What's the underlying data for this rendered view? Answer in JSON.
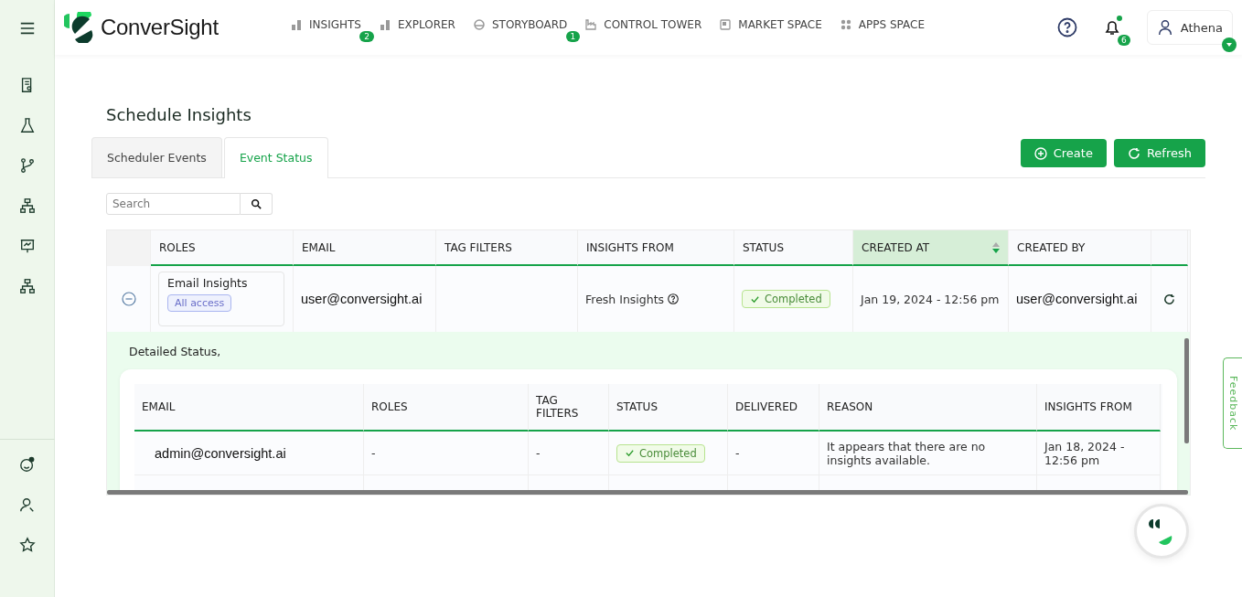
{
  "brand": "ConverSight",
  "nav": [
    {
      "label": "INSIGHTS",
      "badge": "2"
    },
    {
      "label": "EXPLORER"
    },
    {
      "label": "STORYBOARD",
      "badge": "1"
    },
    {
      "label": "CONTROL TOWER"
    },
    {
      "label": "MARKET SPACE"
    },
    {
      "label": "APPS SPACE"
    }
  ],
  "notifications": {
    "badge": "6",
    "unread": true
  },
  "user": {
    "name": "Athena"
  },
  "page_title": "Schedule Insights",
  "tabs": [
    {
      "label": "Scheduler Events",
      "selected": false
    },
    {
      "label": "Event Status",
      "selected": true
    }
  ],
  "buttons": [
    "Create",
    "Refresh"
  ],
  "search": {
    "placeholder": "Search"
  },
  "table": {
    "columns": [
      {
        "label": "ROLES",
        "sorted": false
      },
      {
        "label": "EMAIL",
        "sorted": false
      },
      {
        "label": "TAG FILTERS",
        "sorted": false
      },
      {
        "label": "INSIGHTS FROM",
        "sorted": false
      },
      {
        "label": "STATUS",
        "sorted": false
      },
      {
        "label": "CREATED AT",
        "sorted": true
      },
      {
        "label": "CREATED BY",
        "sorted": false
      }
    ],
    "rows": [
      {
        "expanded": true,
        "role": "Email Insights",
        "access": "All access",
        "email": "user@conversight.ai",
        "insights_from": "Fresh Insights",
        "status": "Completed",
        "created_at": "Jan 19, 2024 - 12:56 pm",
        "created_by": "user@conversight.ai"
      }
    ]
  },
  "detail": {
    "title": "Detailed Status,",
    "columns": [
      "EMAIL",
      "ROLES",
      "TAG FILTERS",
      "STATUS",
      "DELIVERED",
      "REASON",
      "INSIGHTS FROM"
    ],
    "rows": [
      {
        "email": "admin@conversight.ai",
        "roles": "-",
        "tag_filters": "-",
        "status": "Completed",
        "delivered": "-",
        "reason": "It appears that there are no insights available.",
        "insights_from": "Jan 18, 2024 - 12:56 pm"
      }
    ]
  },
  "feedback": "Feedback"
}
